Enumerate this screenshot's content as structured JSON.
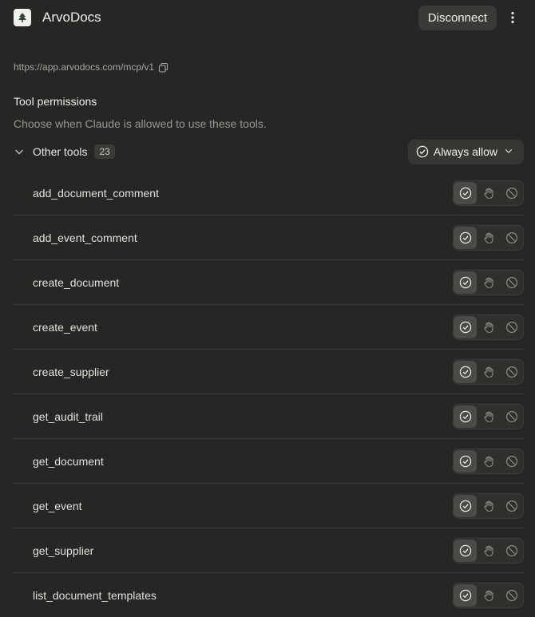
{
  "header": {
    "app_name": "ArvoDocs",
    "logo_icon": "tree-icon",
    "disconnect_label": "Disconnect",
    "more_icon": "vertical-dots-icon"
  },
  "connection": {
    "url": "https://app.arvodocs.com/mcp/v1",
    "copy_icon": "copy-icon"
  },
  "permissions": {
    "title": "Tool permissions",
    "description": "Choose when Claude is allowed to use these tools."
  },
  "group": {
    "label": "Other tools",
    "count": "23",
    "expanded": true,
    "policy_label": "Always allow"
  },
  "tools": [
    {
      "name": "add_document_comment",
      "selected": "allow"
    },
    {
      "name": "add_event_comment",
      "selected": "allow"
    },
    {
      "name": "create_document",
      "selected": "allow"
    },
    {
      "name": "create_event",
      "selected": "allow"
    },
    {
      "name": "create_supplier",
      "selected": "allow"
    },
    {
      "name": "get_audit_trail",
      "selected": "allow"
    },
    {
      "name": "get_document",
      "selected": "allow"
    },
    {
      "name": "get_event",
      "selected": "allow"
    },
    {
      "name": "get_supplier",
      "selected": "allow"
    },
    {
      "name": "list_document_templates",
      "selected": "allow"
    }
  ],
  "colors": {
    "background": "#262624",
    "active_segment": "#4a4a46",
    "divider": "#3a3a37"
  }
}
